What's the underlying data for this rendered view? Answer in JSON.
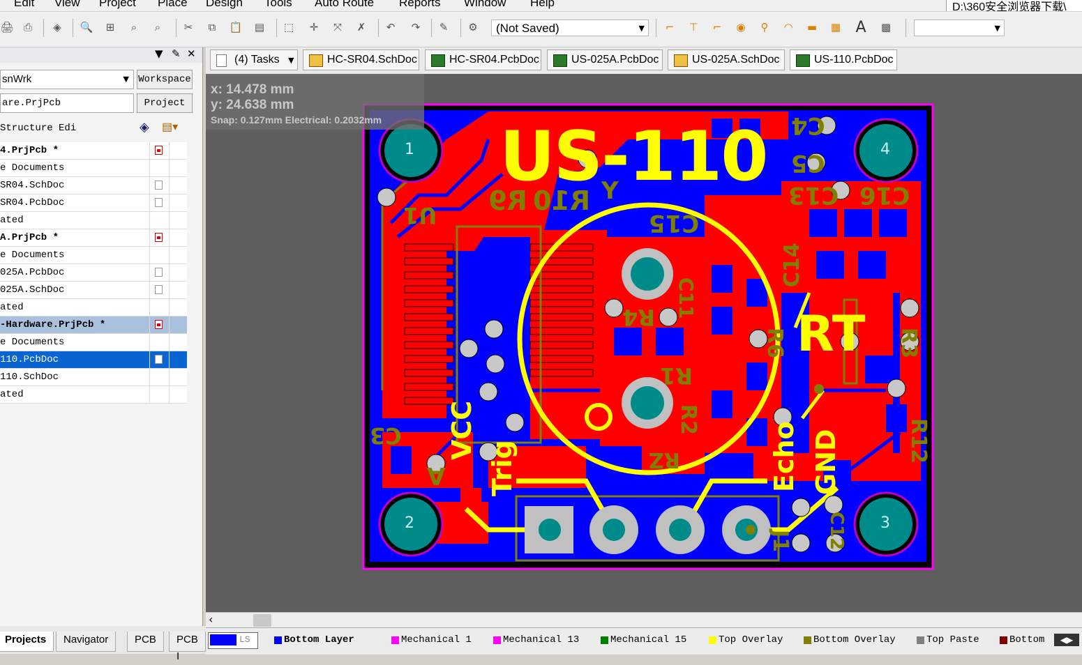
{
  "menu": [
    "Edit",
    "View",
    "Project",
    "Place",
    "Design",
    "Tools",
    "Auto Route",
    "Reports",
    "Window",
    "Help"
  ],
  "path_box": "D:\\360安全浏览器下载\\",
  "toolbar": {
    "not_saved": "(Not Saved)"
  },
  "left_panel": {
    "workspace_value": "snWrk",
    "workspace_button": "Workspace",
    "project_value": "are.PrjPcb",
    "project_button": "Project",
    "structure_label": "Structure Edi",
    "tree": [
      {
        "text": "4.PrjPcb *",
        "bold": true,
        "icon": "red"
      },
      {
        "text": "e Documents",
        "bold": false,
        "icon": ""
      },
      {
        "text": "SR04.SchDoc",
        "bold": false,
        "icon": "doc"
      },
      {
        "text": "SR04.PcbDoc",
        "bold": false,
        "icon": "doc"
      },
      {
        "text": "ated",
        "bold": false,
        "icon": ""
      },
      {
        "text": "A.PrjPcb *",
        "bold": true,
        "icon": "red"
      },
      {
        "text": "e Documents",
        "bold": false,
        "icon": ""
      },
      {
        "text": "025A.PcbDoc",
        "bold": false,
        "icon": "doc"
      },
      {
        "text": "025A.SchDoc",
        "bold": false,
        "icon": "doc"
      },
      {
        "text": "ated",
        "bold": false,
        "icon": ""
      },
      {
        "text": "-Hardware.PrjPcb *",
        "bold": true,
        "icon": "red",
        "hl": true
      },
      {
        "text": "e Documents",
        "bold": false,
        "icon": ""
      },
      {
        "text": "110.PcbDoc",
        "bold": false,
        "icon": "doc",
        "sel": true
      },
      {
        "text": "110.SchDoc",
        "bold": false,
        "icon": ""
      },
      {
        "text": "ated",
        "bold": false,
        "icon": ""
      }
    ]
  },
  "panel_tabs": [
    "Projects",
    "Navigator",
    "PCB",
    "PCB I"
  ],
  "doc_tabs": [
    "(4) Tasks",
    "HC-SR04.SchDoc",
    "HC-SR04.PcbDoc",
    "US-025A.PcbDoc",
    "US-025A.SchDoc",
    "US-110.PcbDoc"
  ],
  "coords": {
    "x": "x: 14.478 mm",
    "y": "y: 24.638 mm",
    "snap": "Snap: 0.127mm Electrical: 0.2032mm"
  },
  "pcb": {
    "title": "US-110",
    "mount_holes": [
      "1",
      "4",
      "2",
      "3"
    ],
    "labels": {
      "vcc": "VCC",
      "trig": "Trig",
      "echo": "Echo",
      "gnd": "GND",
      "rt": "RT",
      "r9": "R9",
      "r10": "R10",
      "y": "Y",
      "c15": "C15",
      "c4": "C4",
      "c5": "C5",
      "c13": "C13",
      "c16": "C16",
      "c14": "C14",
      "c11": "C11",
      "r4": "R4",
      "r1": "R1",
      "r2": "R2",
      "r3": "R3",
      "r12": "R12",
      "u1": "U1",
      "j1": "J1",
      "c3": "C3",
      "r6": "R6",
      "rz": "RZ",
      "c12": "C12",
      "a": "A"
    }
  },
  "layers": [
    {
      "name": "Bottom Layer",
      "color": "#0000ff",
      "active": true
    },
    {
      "name": "Mechanical 1",
      "color": "#ff00ff"
    },
    {
      "name": "Mechanical 13",
      "color": "#ff00ff"
    },
    {
      "name": "Mechanical 15",
      "color": "#008000"
    },
    {
      "name": "Top Overlay",
      "color": "#ffff00"
    },
    {
      "name": "Bottom Overlay",
      "color": "#808000"
    },
    {
      "name": "Top Paste",
      "color": "#808080"
    },
    {
      "name": "Bottom",
      "color": "#800000"
    }
  ],
  "ls_label": "LS"
}
